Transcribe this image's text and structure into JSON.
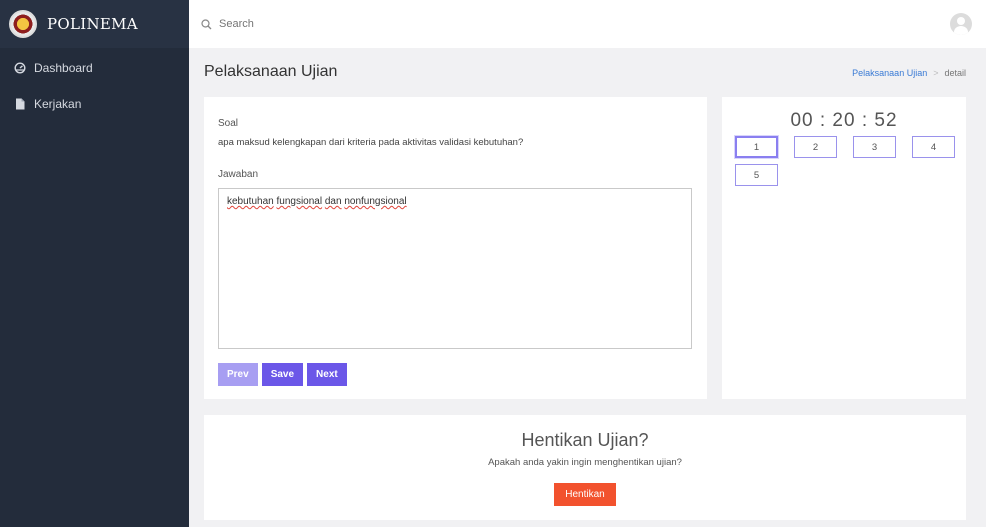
{
  "app": {
    "brand": "POLINEMA"
  },
  "sidebar": {
    "items": [
      {
        "label": "Dashboard",
        "icon": "dashboard-icon"
      },
      {
        "label": "Kerjakan",
        "icon": "file-icon"
      }
    ]
  },
  "topbar": {
    "search_placeholder": "Search"
  },
  "page": {
    "title": "Pelaksanaan Ujian",
    "breadcrumb": {
      "link": "Pelaksanaan Ujian",
      "current": "detail"
    }
  },
  "question": {
    "soal_label": "Soal",
    "text": "apa maksud kelengkapan dari kriteria pada aktivitas validasi kebutuhan?",
    "jawaban_label": "Jawaban",
    "answer_words": [
      "kebutuhan",
      "fungsional",
      "dan",
      "nonfungsional"
    ]
  },
  "buttons": {
    "prev": "Prev",
    "save": "Save",
    "next": "Next"
  },
  "timer": "00 : 20 : 52",
  "question_numbers": [
    "1",
    "2",
    "3",
    "4",
    "5"
  ],
  "active_question": "1",
  "stop": {
    "title": "Hentikan Ujian?",
    "subtitle": "Apakah anda yakin ingin menghentikan ujian?",
    "button": "Hentikan"
  },
  "colors": {
    "sidebar": "#232c3b",
    "primary": "#6b57e8",
    "primary_light": "#a79ef2",
    "danger": "#f2522e",
    "link": "#3a7bd5"
  }
}
